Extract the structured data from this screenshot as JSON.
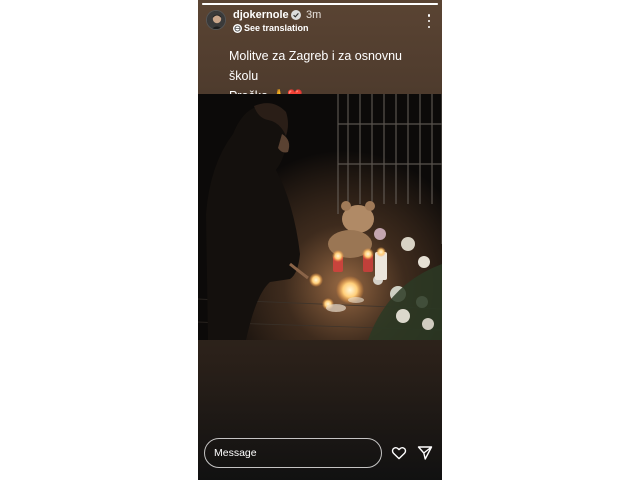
{
  "story": {
    "progress": 1.0,
    "username": "djokernole",
    "verified": true,
    "time_ago": "3m",
    "translate_label": "See translation",
    "caption_line1": "Molitve za Zagreb i za osnovnu školu",
    "caption_line2": "Prečko 🙏❤️",
    "photo_icon": "candle-vigil-photo"
  },
  "reply": {
    "placeholder": "Message",
    "like_icon": "heart-icon",
    "send_icon": "send-icon"
  },
  "colors": {
    "background_top": "#5a4433",
    "background_bottom": "#111111",
    "text": "#ffffff"
  }
}
